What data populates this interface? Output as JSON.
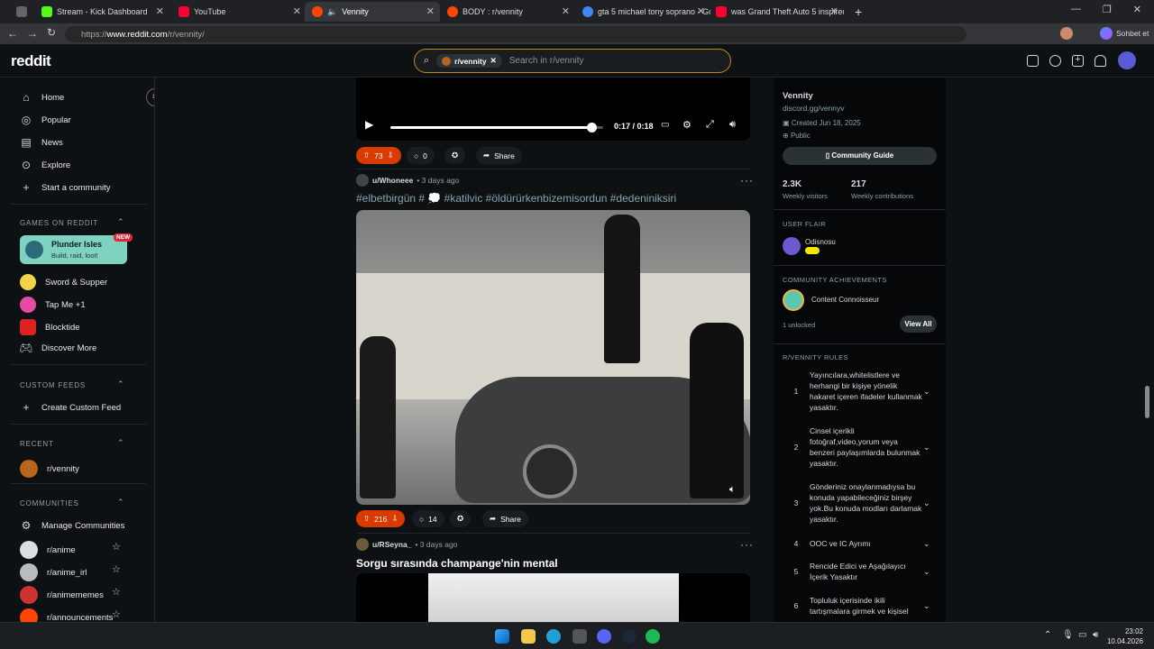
{
  "browser": {
    "tabs": [
      {
        "title": "Stream - Kick Dashboard",
        "color": "#53fc18"
      },
      {
        "title": "YouTube",
        "color": "#ff0033"
      },
      {
        "title": "Vennity",
        "color": "#ff4500"
      },
      {
        "title": "BODY : r/vennity",
        "color": "#ff4500"
      },
      {
        "title": "gta 5 michael tony soprano - Goo",
        "color": "#4285f4"
      },
      {
        "title": "was Grand Theft Auto 5 inspired b",
        "color": "#ff0033"
      }
    ],
    "url_prefix": "https://",
    "url_domain": "www.reddit.com",
    "url_path": "/r/vennity/",
    "profile_label": "Sohbet et"
  },
  "header": {
    "logo": "reddit",
    "search_chip": "r/vennity",
    "search_placeholder": "Search in r/vennity"
  },
  "sidebar": {
    "nav": [
      {
        "label": "Home",
        "icon": "home-icon",
        "glyph": "⌂"
      },
      {
        "label": "Popular",
        "icon": "popular-icon",
        "glyph": "◎"
      },
      {
        "label": "News",
        "icon": "news-icon",
        "glyph": "▤"
      },
      {
        "label": "Explore",
        "icon": "explore-icon",
        "glyph": "⊙"
      },
      {
        "label": "Start a community",
        "icon": "plus-icon",
        "glyph": "+"
      }
    ],
    "games_heading": "GAMES ON REDDIT",
    "featured_game": {
      "title": "Plunder Isles",
      "subtitle": "Build, raid, loot!",
      "badge": "NEW"
    },
    "games": [
      "Sword & Supper",
      "Tap Me +1",
      "Blocktide",
      "Discover More"
    ],
    "custom_heading": "CUSTOM FEEDS",
    "custom_items": [
      "Create Custom Feed"
    ],
    "recent_heading": "RECENT",
    "recent_items": [
      "r/vennity"
    ],
    "communities_heading": "COMMUNITIES",
    "manage": "Manage Communities",
    "communities": [
      "r/anime",
      "r/anime_irl",
      "r/animememes",
      "r/announcements"
    ]
  },
  "feed": {
    "video": {
      "time": "0:17 / 0:18",
      "progress": 0.944
    },
    "post1": {
      "upvotes": "73",
      "comments": "0",
      "share": "Share"
    },
    "post2": {
      "user": "u/Whoneee",
      "age": "• 3 days ago",
      "title": "#elbetbirgün # 💭 #katilvic #öldürürkenbizemisordun #dedeniniksiri",
      "upvotes": "216",
      "comments": "14",
      "share": "Share"
    },
    "post3": {
      "user": "u/RSeyna_",
      "age": "• 3 days ago",
      "title": "Sorgu sırasında champange'nin mental"
    }
  },
  "community": {
    "name": "Vennity",
    "link": "discord.gg/vennyv",
    "created": "Created Jun 18, 2025",
    "visibility": "Public",
    "guide": "Community Guide",
    "visitors": "2.3K",
    "visitors_label": "Weekly visitors",
    "contributions": "217",
    "contributions_label": "Weekly contributions",
    "flair_heading": "USER FLAIR",
    "flair_user": "Odisnosu",
    "ach_heading": "COMMUNITY ACHIEVEMENTS",
    "achievement": "Content Connoisseur",
    "unlocked": "1 unlocked",
    "view_all": "View All",
    "rules_heading": "R/VENNITY RULES",
    "rules": [
      {
        "n": "1",
        "text": "Yayıncılara,whitelistlere ve herhangi bir kişiye yönelik hakaret içeren ifadeler kullanmak yasaktır."
      },
      {
        "n": "2",
        "text": "Cinsel içerikli fotoğraf,video,yorum veya benzeri paylaşımlarda bulunmak yasaktır."
      },
      {
        "n": "3",
        "text": "Gönderiniz onaylanmadıysa bu konuda yapabileceğiniz birşey yok.Bu konuda modları darlamak yasaktır."
      },
      {
        "n": "4",
        "text": "OOC ve IC Ayrımı"
      },
      {
        "n": "5",
        "text": "Rencide Edici ve Aşağılayıcı İçerik Yasaktır"
      },
      {
        "n": "6",
        "text": "Topluluk içerisinde ikili tartışmalara girmek ve kişisel"
      }
    ]
  },
  "taskbar": {
    "time": "23:02",
    "date": "10.04.2026"
  }
}
